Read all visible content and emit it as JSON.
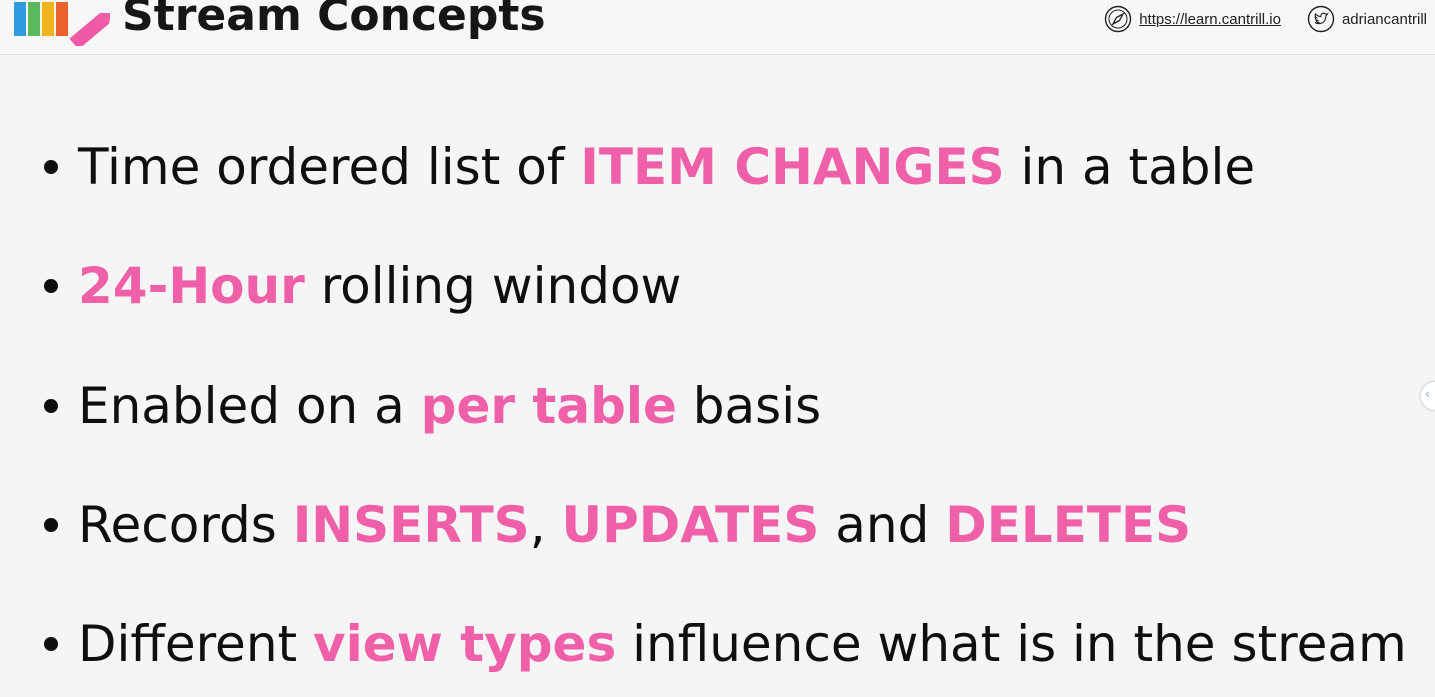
{
  "header": {
    "title": "Stream Concepts",
    "logo_icon": "pencil-bars-logo",
    "website_icon": "compass-icon",
    "website": "https://learn.cantrill.io",
    "twitter_icon": "twitter-icon",
    "twitter_handle": "adriancantrill"
  },
  "colors": {
    "highlight": "#ef60a8",
    "text": "#0f0f0f",
    "background": "#f5f5f5"
  },
  "bullets": [
    {
      "parts": [
        {
          "text": "Time ordered list of ",
          "highlight": false
        },
        {
          "text": "ITEM CHANGES",
          "highlight": true
        },
        {
          "text": " in a table",
          "highlight": false
        }
      ]
    },
    {
      "parts": [
        {
          "text": "24-Hour",
          "highlight": true
        },
        {
          "text": " rolling window",
          "highlight": false
        }
      ]
    },
    {
      "parts": [
        {
          "text": "Enabled on a ",
          "highlight": false
        },
        {
          "text": "per table",
          "highlight": true
        },
        {
          "text": " basis",
          "highlight": false
        }
      ]
    },
    {
      "parts": [
        {
          "text": "Records ",
          "highlight": false
        },
        {
          "text": "INSERTS",
          "highlight": true
        },
        {
          "text": ", ",
          "highlight": false
        },
        {
          "text": "UPDATES",
          "highlight": true
        },
        {
          "text": " and ",
          "highlight": false
        },
        {
          "text": "DELETES",
          "highlight": true
        }
      ]
    },
    {
      "parts": [
        {
          "text": "Different ",
          "highlight": false
        },
        {
          "text": "view types",
          "highlight": true
        },
        {
          "text": " influence what is in the stream",
          "highlight": false
        }
      ]
    }
  ]
}
